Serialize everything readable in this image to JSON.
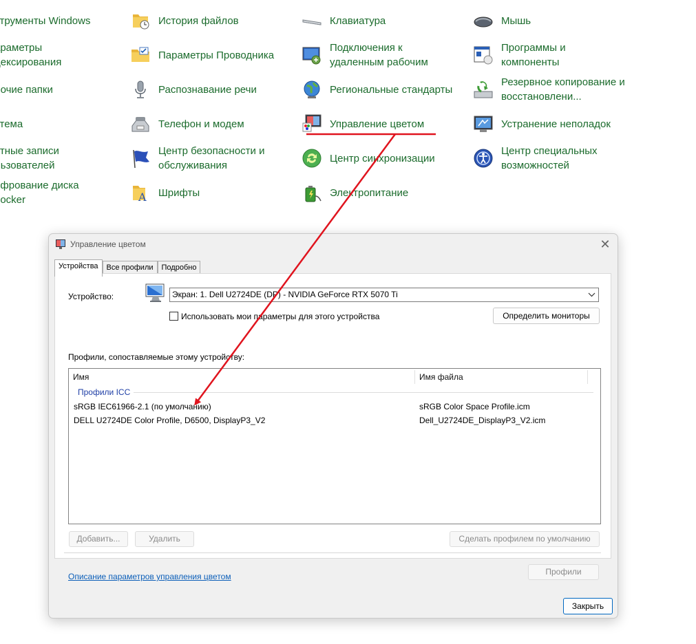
{
  "control_panel": {
    "items": [
      {
        "label": "струменты Windows",
        "icon": "tools-icon"
      },
      {
        "label": "араметры\nдексирования",
        "icon": "indexing-icon"
      },
      {
        "label": "бочие папки",
        "icon": "work-folders-icon"
      },
      {
        "label": "стема",
        "icon": "system-icon"
      },
      {
        "label": "етные записи\nльзователей",
        "icon": "user-accounts-icon"
      },
      {
        "label": "ифрование диска\nLocker",
        "icon": "bitlocker-icon"
      },
      {
        "label": "История файлов",
        "icon": "file-history-icon"
      },
      {
        "label": "Параметры Проводника",
        "icon": "explorer-options-icon"
      },
      {
        "label": "Распознавание речи",
        "icon": "microphone-icon"
      },
      {
        "label": "Телефон и модем",
        "icon": "phone-modem-icon"
      },
      {
        "label": "Центр безопасности и\nобслуживания",
        "icon": "flag-icon"
      },
      {
        "label": "Шрифты",
        "icon": "fonts-folder-icon"
      },
      {
        "label": "Клавиатура",
        "icon": "keyboard-icon"
      },
      {
        "label": "Подключения к\nудаленным рабочим",
        "icon": "remote-desktop-icon"
      },
      {
        "label": "Региональные стандарты",
        "icon": "globe-icon"
      },
      {
        "label": "Управление цветом",
        "icon": "color-management-icon"
      },
      {
        "label": "Центр синхронизации",
        "icon": "sync-icon"
      },
      {
        "label": "Электропитание",
        "icon": "power-options-icon"
      },
      {
        "label": "Мышь",
        "icon": "mouse-icon"
      },
      {
        "label": "Программы и\nкомпоненты",
        "icon": "programs-icon"
      },
      {
        "label": "Резервное копирование и\nвосстановлени...",
        "icon": "backup-icon"
      },
      {
        "label": "Устранение неполадок",
        "icon": "troubleshoot-icon"
      },
      {
        "label": "Центр специальных\nвозможностей",
        "icon": "accessibility-icon"
      }
    ]
  },
  "annotation": {
    "color": "#e0141e"
  },
  "dialog": {
    "title": "Управление цветом",
    "close_glyph": "✕",
    "tabs": [
      {
        "label": "Устройства"
      },
      {
        "label": "Все профили"
      },
      {
        "label": "Подробно"
      }
    ],
    "device_label": "Устройство:",
    "device_value": "Экран: 1. Dell U2724DE (DP) - NVIDIA GeForce RTX 5070 Ti",
    "use_my_settings_label": "Использовать мои параметры для этого устройства",
    "use_my_settings_checked": false,
    "identify_monitors_label": "Определить мониторы",
    "profiles_caption": "Профили, сопоставляемые этому устройству:",
    "columns": {
      "name": "Имя",
      "file": "Имя файла"
    },
    "group_label": "Профили ICC",
    "profiles": [
      {
        "name": "sRGB IEC61966-2.1 (по умолчанию)",
        "file": "sRGB Color Space Profile.icm"
      },
      {
        "name": "DELL U2724DE Color Profile, D6500, DisplayP3_V2",
        "file": "Dell_U2724DE_DisplayP3_V2.icm"
      }
    ],
    "add_label": "Добавить...",
    "remove_label": "Удалить",
    "set_default_label": "Сделать профилем по умолчанию",
    "help_link": "Описание параметров управления цветом",
    "profiles_button": "Профили",
    "close_button": "Закрыть"
  }
}
